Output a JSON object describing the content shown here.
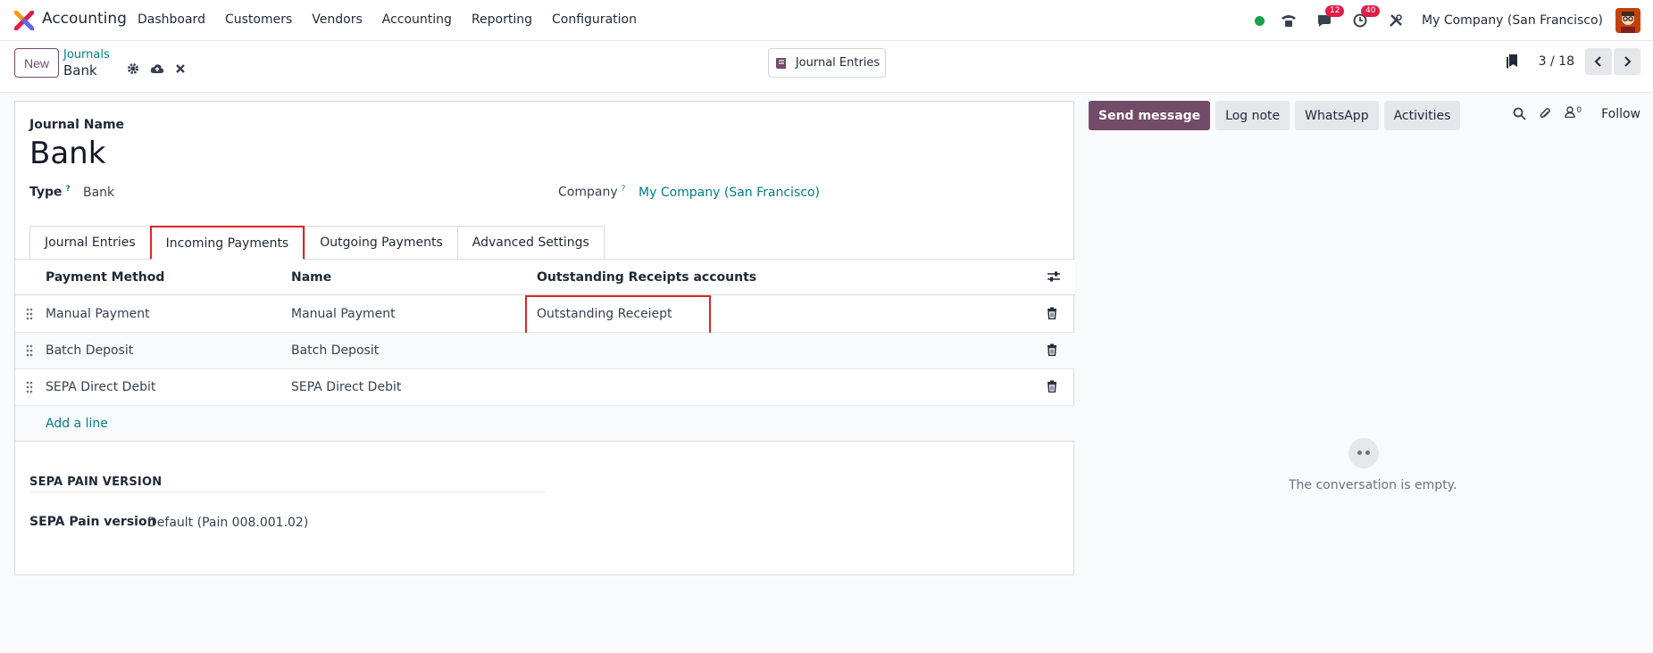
{
  "app": {
    "name": "Accounting"
  },
  "nav": {
    "items": [
      "Dashboard",
      "Customers",
      "Vendors",
      "Accounting",
      "Reporting",
      "Configuration"
    ]
  },
  "systray": {
    "messages_count": "12",
    "activities_count": "40",
    "company": "My Company (San Francisco)"
  },
  "control": {
    "new_label": "New",
    "breadcrumb_parent": "Journals",
    "breadcrumb_current": "Bank",
    "smart_button": "Journal Entries",
    "pager": "3 / 18"
  },
  "form": {
    "journal_name_label": "Journal Name",
    "journal_name": "Bank",
    "type_label": "Type",
    "type_value": "Bank",
    "company_label": "Company",
    "company_value": "My Company (San Francisco)",
    "help_mark": "?"
  },
  "tabs": [
    "Journal Entries",
    "Incoming Payments",
    "Outgoing Payments",
    "Advanced Settings"
  ],
  "active_tab": "Incoming Payments",
  "table": {
    "headers": [
      "Payment Method",
      "Name",
      "Outstanding Receipts accounts"
    ],
    "rows": [
      {
        "method": "Manual Payment",
        "name": "Manual Payment",
        "account": "Outstanding Receiept"
      },
      {
        "method": "Batch Deposit",
        "name": "Batch Deposit",
        "account": ""
      },
      {
        "method": "SEPA Direct Debit",
        "name": "SEPA Direct Debit",
        "account": ""
      }
    ],
    "add_line": "Add a line"
  },
  "sepa": {
    "section_title": "SEPA PAIN VERSION",
    "label": "SEPA Pain version",
    "value": "Default (Pain 008.001.02)"
  },
  "chatter": {
    "send_message": "Send message",
    "log_note": "Log note",
    "whatsapp": "WhatsApp",
    "activities": "Activities",
    "followers_count": "0",
    "follow": "Follow",
    "empty_text": "The conversation is empty."
  },
  "colors": {
    "brand": "#714b67",
    "link": "#017e84",
    "highlight": "#dc2626"
  }
}
